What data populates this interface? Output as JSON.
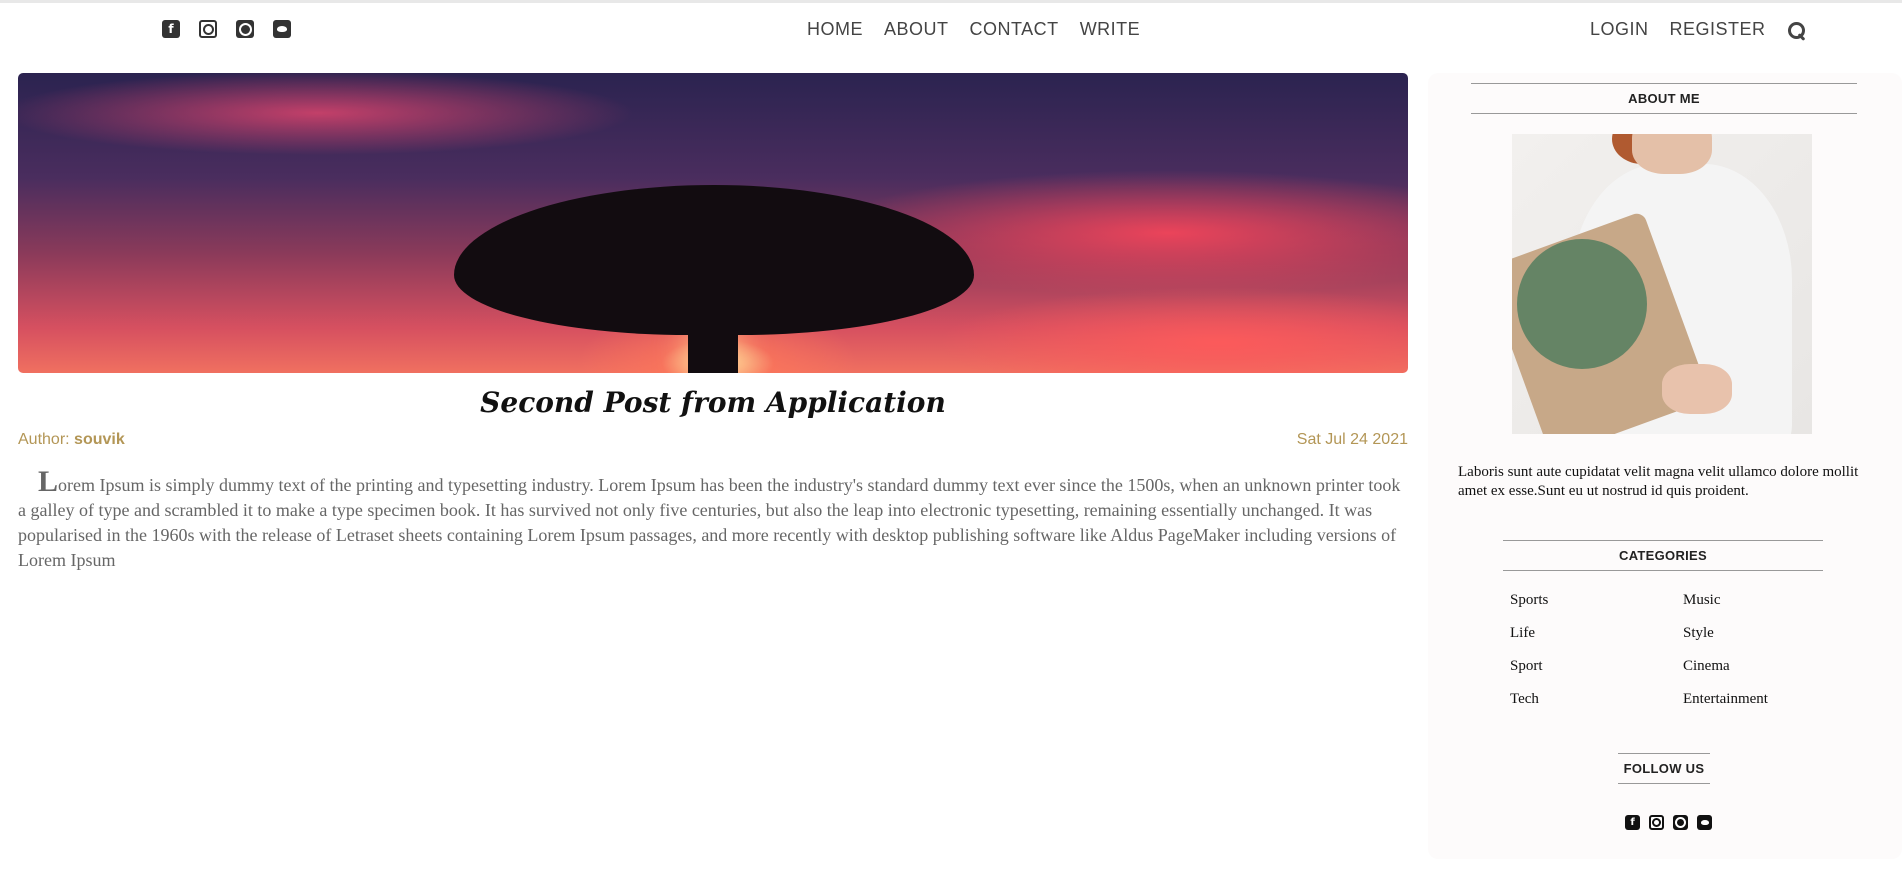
{
  "topbar": {
    "social_icons": [
      "facebook-icon",
      "instagram-icon",
      "pinterest-icon",
      "twitter-icon"
    ],
    "facebook_glyph": "f",
    "nav": {
      "home": "HOME",
      "about": "ABOUT",
      "contact": "CONTACT",
      "write": "WRITE"
    },
    "auth": {
      "login": "LOGIN",
      "register": "REGISTER"
    }
  },
  "post": {
    "title": "Second Post from Application",
    "author_label": "Author:",
    "author_name": "souvik",
    "date": "Sat Jul 24 2021",
    "dropcap": "L",
    "body": "orem Ipsum is simply dummy text of the printing and typesetting industry. Lorem Ipsum has been the industry's standard dummy text ever since the 1500s, when an unknown printer took a galley of type and scrambled it to make a type specimen book. It has survived not only five centuries, but also the leap into electronic typesetting, remaining essentially unchanged. It was popularised in the 1960s with the release of Letraset sheets containing Lorem Ipsum passages, and more recently with desktop publishing software like Aldus PageMaker including versions of Lorem Ipsum"
  },
  "sidebar": {
    "about_title": "ABOUT ME",
    "about_text": "Laboris sunt aute cupidatat velit magna velit ullamco dolore mollit amet ex esse.Sunt eu ut nostrud id quis proident.",
    "categories_title": "CATEGORIES",
    "categories": [
      "Sports",
      "Music",
      "Life",
      "Style",
      "Sport",
      "Cinema",
      "Tech",
      "Entertainment"
    ],
    "follow_title": "FOLLOW US"
  },
  "colors": {
    "accent_gold": "#b39656",
    "text_dark": "#111111",
    "sidebar_bg": "#fdfbfb"
  }
}
